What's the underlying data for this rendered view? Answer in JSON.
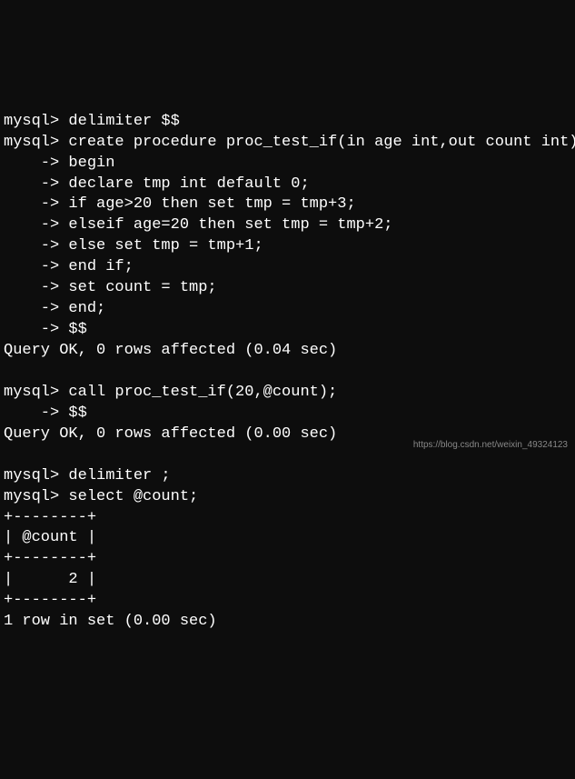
{
  "terminal": {
    "lines": [
      "mysql> delimiter $$",
      "mysql> create procedure proc_test_if(in age int,out count int)",
      "    -> begin",
      "    -> declare tmp int default 0;",
      "    -> if age>20 then set tmp = tmp+3;",
      "    -> elseif age=20 then set tmp = tmp+2;",
      "    -> else set tmp = tmp+1;",
      "    -> end if;",
      "    -> set count = tmp;",
      "    -> end;",
      "    -> $$",
      "Query OK, 0 rows affected (0.04 sec)",
      "",
      "mysql> call proc_test_if(20,@count);",
      "    -> $$",
      "Query OK, 0 rows affected (0.00 sec)",
      "",
      "mysql> delimiter ;",
      "mysql> select @count;",
      "+--------+",
      "| @count |",
      "+--------+",
      "|      2 |",
      "+--------+",
      "1 row in set (0.00 sec)"
    ]
  },
  "watermark": "https://blog.csdn.net/weixin_49324123"
}
